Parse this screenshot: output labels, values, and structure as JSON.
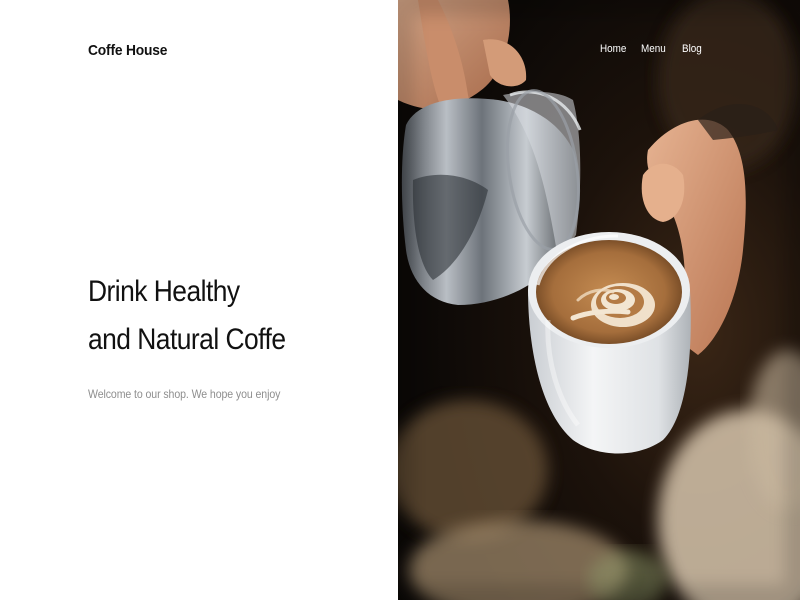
{
  "brand": {
    "name": "Coffe House"
  },
  "nav": {
    "items": [
      {
        "label": "Home"
      },
      {
        "label": "Menu"
      },
      {
        "label": "Blog"
      }
    ]
  },
  "hero": {
    "headline_line1": "Drink Healthy",
    "headline_line2": "and Natural Coffe",
    "subtitle": "Welcome to our shop. We hope you enjoy"
  },
  "photo": {
    "subject": "latte-art-pour",
    "colors": {
      "background": "#140d08",
      "cup": "#e8eaec",
      "coffee": "#b07a45",
      "foam": "#f3e6d2",
      "pitcher": "#8a8f96",
      "skin": "#d9a07c"
    }
  },
  "colors": {
    "text_dark": "#111111",
    "text_muted": "#8e8e8e",
    "nav_text": "#ffffff",
    "page_bg": "#ffffff"
  }
}
